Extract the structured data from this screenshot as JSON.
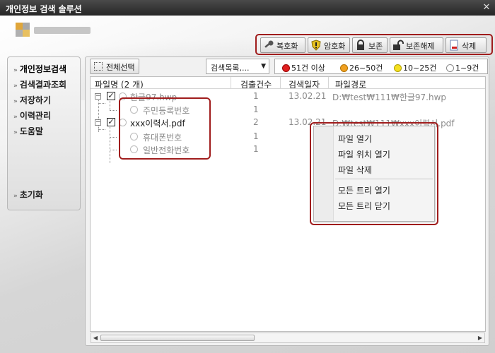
{
  "window": {
    "title": "개인정보 검색 솔루션",
    "close": "✕"
  },
  "toolbar": {
    "decrypt": "복호화",
    "encrypt": "암호화",
    "preserve": "보존",
    "unpreserve": "보존해제",
    "delete": "삭제"
  },
  "sidebar": {
    "items": [
      {
        "label": "개인정보검색"
      },
      {
        "label": "검색결과조회"
      },
      {
        "label": "저장하기"
      },
      {
        "label": "이력관리"
      },
      {
        "label": "도움말"
      },
      {
        "label": "초기화"
      }
    ]
  },
  "controls": {
    "select_all": "전체선택",
    "search_select": "검색목록,..."
  },
  "legend": {
    "items": [
      {
        "label": "51건 이상",
        "color": "#e02020"
      },
      {
        "label": "26~50건",
        "color": "#f0a020"
      },
      {
        "label": "10~25건",
        "color": "#f5e020"
      },
      {
        "label": "1~9건",
        "color": "#ffffff"
      }
    ]
  },
  "table": {
    "headers": [
      "파일명 (2 개)",
      "검출건수",
      "검색일자",
      "파일경로"
    ],
    "files": [
      {
        "name": "한글97.hwp",
        "count": "1",
        "date": "13.02.21",
        "path": "D:₩test₩111₩한글97.hwp",
        "children": [
          {
            "name": "주민등록번호",
            "count": "1"
          }
        ]
      },
      {
        "name": "xxx이력서.pdf",
        "count": "2",
        "date": "13.02.21",
        "path": "D:₩test₩111₩xxx이력서.pdf",
        "children": [
          {
            "name": "휴대폰번호",
            "count": "1"
          },
          {
            "name": "일반전화번호",
            "count": "1"
          }
        ]
      }
    ]
  },
  "context_menu": {
    "items": [
      "파일 열기",
      "파일 위치 열기",
      "파일 삭제",
      "모든 트리 열기",
      "모든 트리 닫기"
    ]
  },
  "colors": {
    "highlight": "#a01c1c",
    "titlebar": "#303030"
  }
}
